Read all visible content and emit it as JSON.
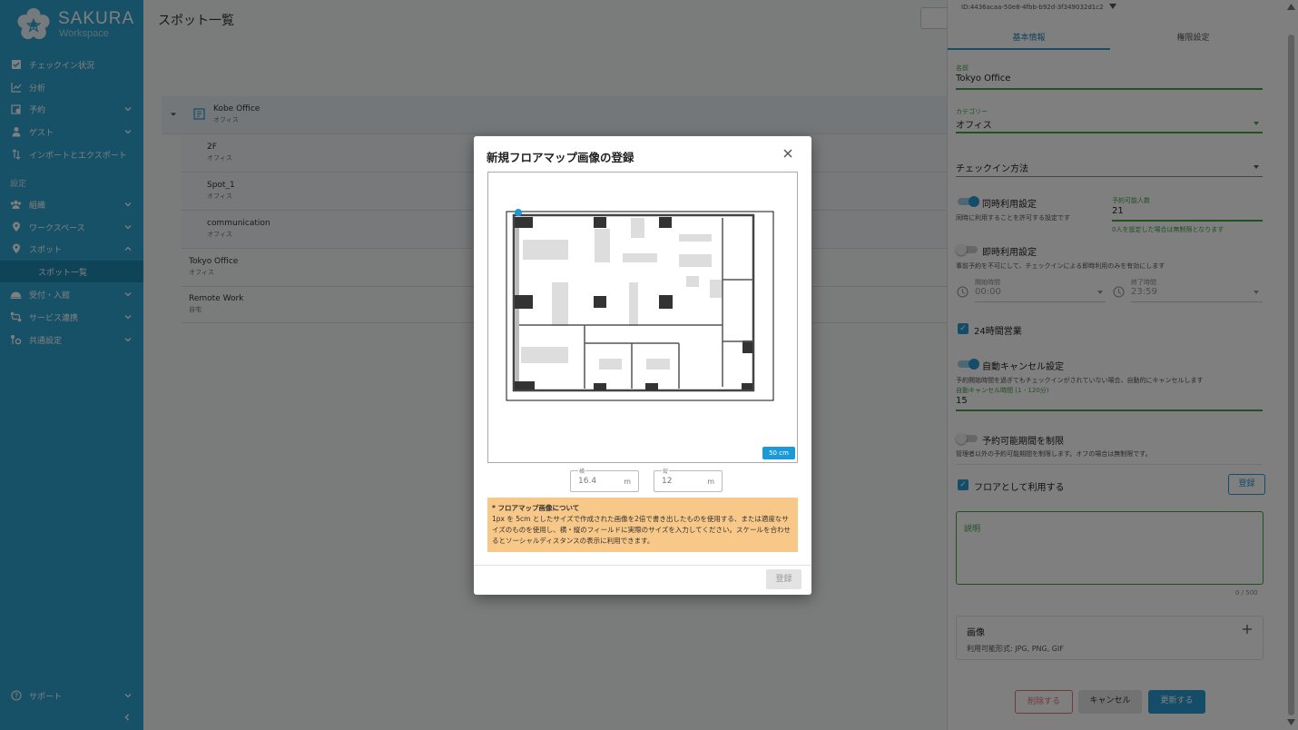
{
  "sidebar": {
    "logo_main": "SAKURA",
    "logo_sub": "Workspace",
    "items": [
      {
        "label": "チェックイン状況"
      },
      {
        "label": "分析"
      },
      {
        "label": "予約"
      },
      {
        "label": "ゲスト"
      },
      {
        "label": "インポートとエクスポート"
      },
      {
        "label": "組織"
      },
      {
        "label": "ワークスペース"
      },
      {
        "label": "スポット"
      },
      {
        "label": "スポット一覧"
      },
      {
        "label": "受付・入館"
      },
      {
        "label": "サービス連携"
      },
      {
        "label": "共通設定"
      }
    ],
    "section_label": "設定",
    "support_label": "サポート"
  },
  "main": {
    "title": "スポット一覧",
    "rows": [
      {
        "name": "Kobe Office",
        "sub": "オフィス"
      },
      {
        "name": "2F",
        "sub": "オフィス"
      },
      {
        "name": "Spot_1",
        "sub": "オフィス"
      },
      {
        "name": "communication",
        "sub": "オフィス"
      },
      {
        "name": "Tokyo Office",
        "sub": "オフィス"
      },
      {
        "name": "Remote Work",
        "sub": "自宅"
      }
    ]
  },
  "panel": {
    "id_text": "ID:4436acaa-50e8-4fbb-b92d-3f349032d1c2",
    "tabs": [
      "基本情報",
      "権限設定"
    ],
    "name_label": "名前",
    "name_value": "Tokyo Office",
    "category_label": "カテゴリー",
    "category_value": "オフィス",
    "checkin_label": "チェックイン方法",
    "concurrent_title": "同時利用設定",
    "concurrent_desc": "同時に利用することを許可する設定です",
    "capacity_label": "予約可能人数",
    "capacity_value": "21",
    "capacity_hint": "0人を設定した場合は無制限となります",
    "instant_title": "即時利用設定",
    "instant_desc": "事前予約を不可にして、チェックインによる即時利用のみを有効にします",
    "start_label": "開始時間",
    "start_value": "00:00",
    "end_label": "終了時間",
    "end_value": "23:59",
    "allday_label": "24時間営業",
    "autocancel_title": "自動キャンセル設定",
    "autocancel_desc": "予約開始時間を過ぎてもチェックインがされていない場合、自動的にキャンセルします",
    "autocancel_time_label": "自動キャンセル時間 (1 - 120分)",
    "autocancel_time_value": "15",
    "period_title": "予約可能期間を制限",
    "period_desc": "管理者以外の予約可能期間を制限します。オフの場合は無制限です。",
    "floor_label": "フロアとして利用する",
    "register_label": "登録",
    "description_label": "説明",
    "counter": "0 / 500",
    "image_title": "画像",
    "image_formats": "利用可能形式: JPG, PNG, GIF",
    "delete_label": "削除する",
    "cancel_label": "キャンセル",
    "update_label": "更新する"
  },
  "modal": {
    "title": "新規フロアマップ画像の登録",
    "scale_badge": "50 cm",
    "width_label": "横",
    "width_value": "16.4",
    "height_label": "縦",
    "height_value": "12",
    "unit": "m",
    "note_heading": "* フロアマップ画像について",
    "note_body": "1px を 5cm としたサイズで作成された画像を2倍で書き出したものを使用する、または適度なサイズのものを使用し、横・縦のフィールドに実際のサイズを入力してください。スケールを合わせるとソーシャルディスタンスの表示に利用できます。",
    "submit_label": "登録"
  }
}
